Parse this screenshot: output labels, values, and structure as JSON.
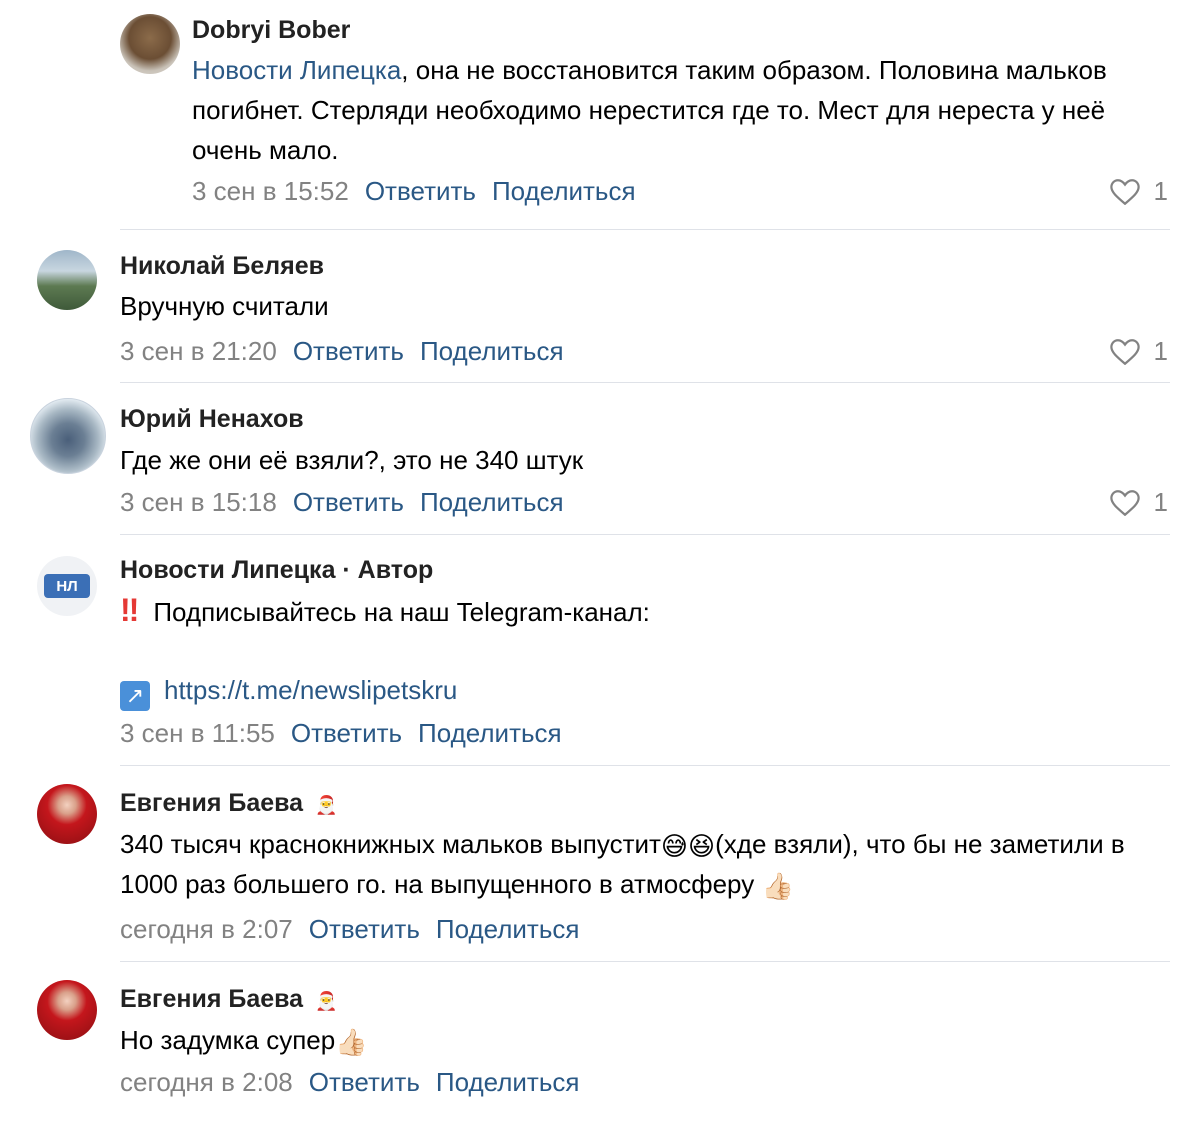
{
  "comments": [
    {
      "author": "Dobryi Bober",
      "reply_to": "Новости Липецка",
      "text": ", она не восстановится таким образом. Половина мальков погибнет. Стерляди необходимо нерестится где то. Мест для нереста у неё очень мало.",
      "time": "3 сен в 15:52",
      "reply": "Ответить",
      "share": "Поделиться",
      "likes": "1"
    },
    {
      "author": "Николай Беляев",
      "text": "Вручную считали",
      "time": "3 сен в 21:20",
      "reply": "Ответить",
      "share": "Поделиться",
      "likes": "1"
    },
    {
      "author": "Юрий Ненахов",
      "text": "Где же они её взяли?, это не 340 штук",
      "time": "3 сен в 15:18",
      "reply": "Ответить",
      "share": "Поделиться",
      "likes": "1"
    },
    {
      "author": "Новости Липецка · Автор",
      "badge": "НЛ",
      "text": "Подписывайтесь на наш Telegram-канал:",
      "url": "https://t.me/newslipetskru",
      "time": "3 сен в 11:55",
      "reply": "Ответить",
      "share": "Поделиться"
    },
    {
      "author": "Евгения Баева",
      "text_part1": "340 тысяч краснокнижных мальков выпустит",
      "text_part2": "(хде взяли), что бы не заметили в 1000 раз большего го. на выпущенного в атмосферу",
      "time": "сегодня в 2:07",
      "reply": "Ответить",
      "share": "Поделиться"
    },
    {
      "author": "Евгения Баева",
      "text": "Но задумка супер",
      "time": "сегодня в 2:08",
      "reply": "Ответить",
      "share": "Поделиться"
    }
  ],
  "icons": {
    "heart": "heart-icon",
    "link": "link-arrow-icon",
    "exclamation": "double-exclamation-icon",
    "thumbs_up": "thumbs-up-icon",
    "sweat_smile": "sweat-smile-icon",
    "laughing": "laughing-icon",
    "santa": "santa-icon"
  },
  "colors": {
    "link": "#2a5885",
    "meta": "#828282",
    "divider": "#dfe2e8"
  }
}
